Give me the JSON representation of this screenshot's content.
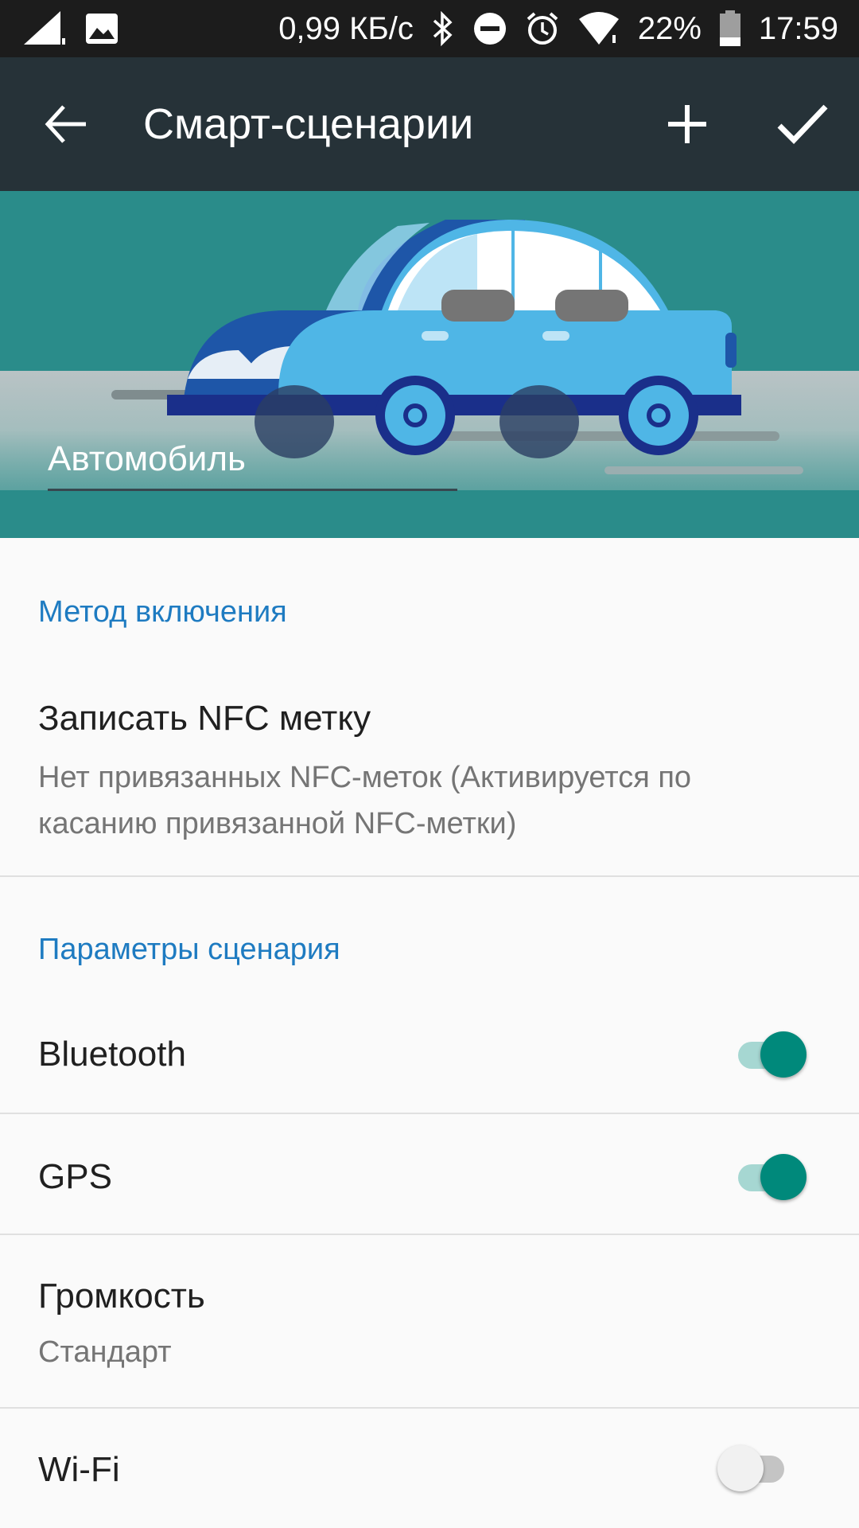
{
  "status_bar": {
    "network_speed": "0,99 КБ/с",
    "battery_percent": "22%",
    "time": "17:59",
    "icons": [
      "signal-icon",
      "image-icon",
      "bluetooth-icon",
      "dnd-icon",
      "alarm-icon",
      "wifi-icon",
      "battery-icon"
    ]
  },
  "app_bar": {
    "title": "Смарт-сценарии",
    "back_icon": "back-arrow-icon",
    "add_icon": "plus-icon",
    "done_icon": "check-icon",
    "background_color": "#263238"
  },
  "hero": {
    "illustration": "car-illustration",
    "name_value": "Автомобиль",
    "background_color": "#2a8c8a"
  },
  "sections": {
    "activation": {
      "header": "Метод включения",
      "nfc_title": "Записать NFC метку",
      "nfc_subtitle": "Нет привязанных NFC-меток (Активируется по касанию привязанной NFC-метки)"
    },
    "params": {
      "header": "Параметры сценария",
      "bluetooth_label": "Bluetooth",
      "bluetooth_on": true,
      "gps_label": "GPS",
      "gps_on": true,
      "volume_label": "Громкость",
      "volume_value": "Стандарт",
      "wifi_label": "Wi-Fi",
      "wifi_on": false
    }
  },
  "colors": {
    "accent": "#1e7bc1",
    "switch_on": "#00897b"
  }
}
